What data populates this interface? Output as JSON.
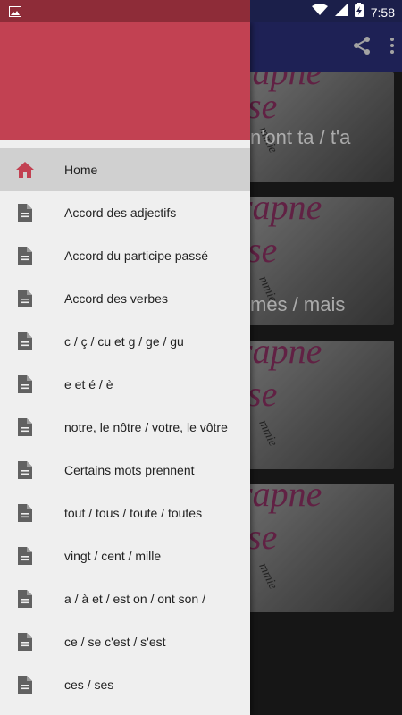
{
  "status_bar": {
    "time": "7:58",
    "icons": [
      "gallery-icon",
      "wifi-icon",
      "signal-icon",
      "battery-charging-icon"
    ]
  },
  "app_bar": {
    "actions": [
      "share-icon",
      "more-vert-icon"
    ]
  },
  "background_cards": [
    {
      "text": "n'ont ta / t'a"
    },
    {
      "text": "mes / mais"
    },
    {
      "text": ""
    },
    {
      "text": ""
    }
  ],
  "drawer": {
    "header_color": "#c24152",
    "items": [
      {
        "label": "Home",
        "icon": "home-icon",
        "active": true
      },
      {
        "label": "Accord des adjectifs",
        "icon": "document-icon"
      },
      {
        "label": "Accord du participe passé",
        "icon": "document-icon"
      },
      {
        "label": "Accord des verbes",
        "icon": "document-icon"
      },
      {
        "label": "c / ç / cu et g / ge / gu",
        "icon": "document-icon"
      },
      {
        "label": "e et é / è",
        "icon": "document-icon"
      },
      {
        "label": "notre, le nôtre / votre, le vôtre",
        "icon": "document-icon"
      },
      {
        "label": "Certains mots prennent",
        "icon": "document-icon"
      },
      {
        "label": "tout / tous / toute / toutes",
        "icon": "document-icon"
      },
      {
        "label": "vingt / cent / mille",
        "icon": "document-icon"
      },
      {
        "label": "a / à et / est on / ont son /",
        "icon": "document-icon"
      },
      {
        "label": "ce / se c'est / s'est",
        "icon": "document-icon"
      },
      {
        "label": "ces / ses",
        "icon": "document-icon"
      }
    ]
  },
  "colors": {
    "accent": "#c24152",
    "app_bar": "#262a6b",
    "home_icon": "#c24152",
    "doc_icon": "#616161"
  }
}
